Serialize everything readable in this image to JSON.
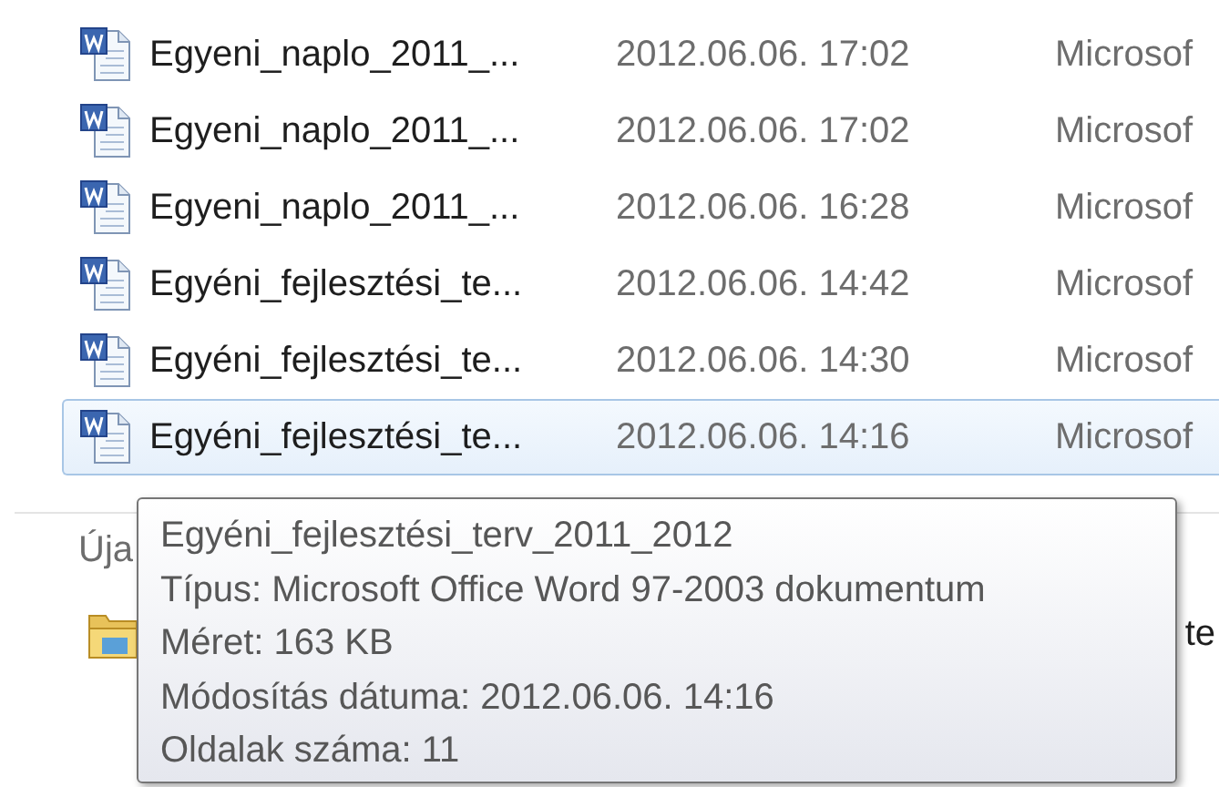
{
  "files": [
    {
      "name": "Egyeni_naplo_2011_...",
      "modified": "2012.06.06. 17:02",
      "type": "Microsof",
      "selected": false
    },
    {
      "name": "Egyeni_naplo_2011_...",
      "modified": "2012.06.06. 17:02",
      "type": "Microsof",
      "selected": false
    },
    {
      "name": "Egyeni_naplo_2011_...",
      "modified": "2012.06.06. 16:28",
      "type": "Microsof",
      "selected": false
    },
    {
      "name": "Egyéni_fejlesztési_te...",
      "modified": "2012.06.06. 14:42",
      "type": "Microsof",
      "selected": false
    },
    {
      "name": "Egyéni_fejlesztési_te...",
      "modified": "2012.06.06. 14:30",
      "type": "Microsof",
      "selected": false
    },
    {
      "name": "Egyéni_fejlesztési_te...",
      "modified": "2012.06.06. 14:16",
      "type": "Microsof",
      "selected": true
    }
  ],
  "section": {
    "label": "Úja"
  },
  "folder_item": {
    "label": "te"
  },
  "tooltip": {
    "lines": [
      "Egyéni_fejlesztési_terv_2011_2012",
      "Típus: Microsoft Office Word 97-2003 dokumentum",
      "Méret: 163 KB",
      "Módosítás dátuma: 2012.06.06. 14:16",
      "Oldalak száma: 11"
    ]
  }
}
